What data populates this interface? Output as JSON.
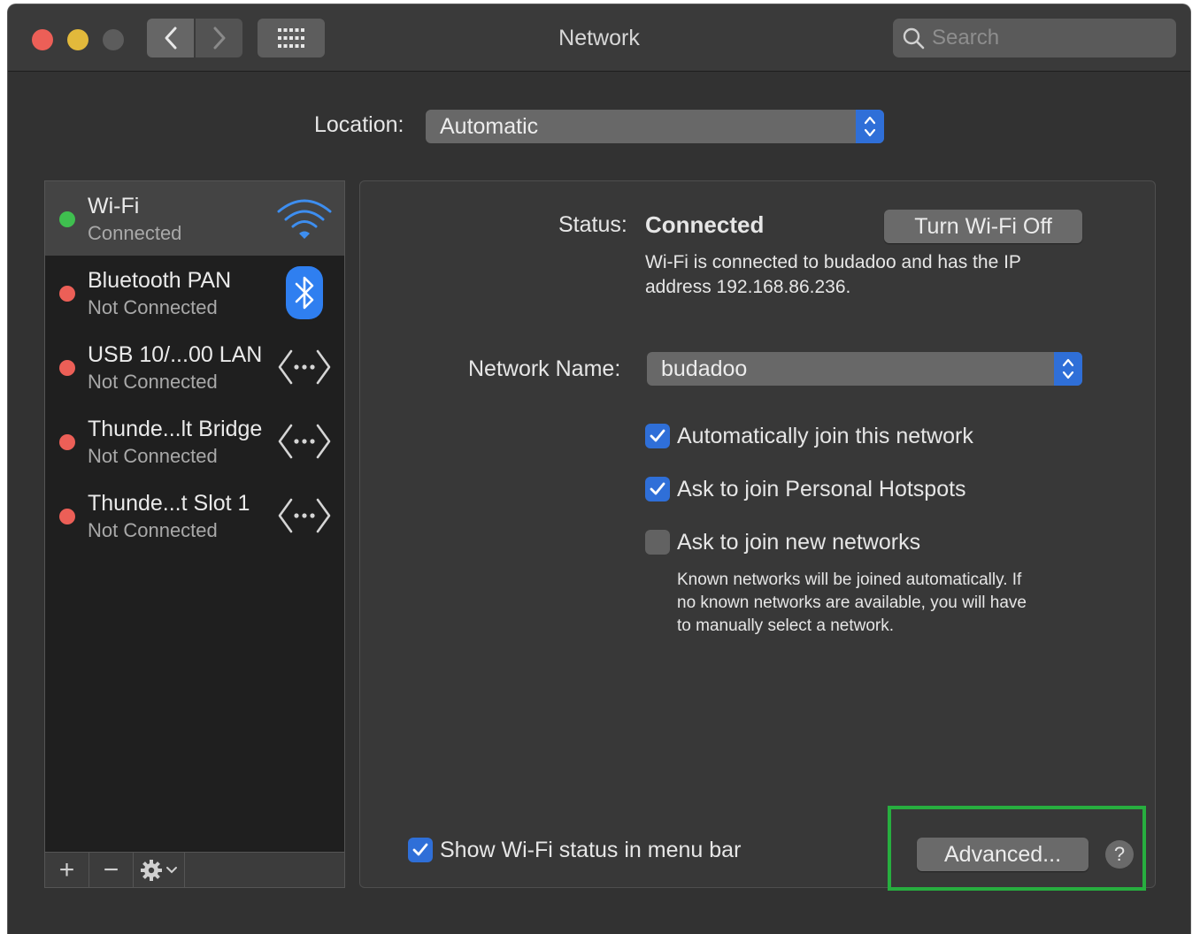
{
  "window": {
    "title": "Network"
  },
  "search": {
    "placeholder": "Search"
  },
  "location": {
    "label": "Location:",
    "value": "Automatic"
  },
  "services": [
    {
      "name": "Wi-Fi",
      "status": "Connected",
      "status_color": "#3fbf4f",
      "icon": "wifi-icon",
      "selected": true
    },
    {
      "name": "Bluetooth PAN",
      "status": "Not Connected",
      "status_color": "#ec5f57",
      "icon": "bluetooth-icon"
    },
    {
      "name": "USB 10/...00 LAN",
      "status": "Not Connected",
      "status_color": "#ec5f57",
      "icon": "network-arrows-icon"
    },
    {
      "name": "Thunde...lt Bridge",
      "status": "Not Connected",
      "status_color": "#ec5f57",
      "icon": "network-arrows-icon"
    },
    {
      "name": "Thunde...t Slot  1",
      "status": "Not Connected",
      "status_color": "#ec5f57",
      "icon": "network-arrows-icon"
    }
  ],
  "sidebar_toolbar": {
    "add": "+",
    "remove": "−"
  },
  "panel": {
    "status_label": "Status:",
    "status_value": "Connected",
    "turn_off_button": "Turn Wi-Fi Off",
    "status_desc_line1": "Wi-Fi is connected to budadoo and has the IP",
    "status_desc_line2": "address 192.168.86.236.",
    "network_name_label": "Network Name:",
    "network_name_value": "budadoo",
    "options": [
      {
        "label": "Automatically join this network",
        "checked": true
      },
      {
        "label": "Ask to join Personal Hotspots",
        "checked": true
      },
      {
        "label": "Ask to join new networks",
        "checked": false
      }
    ],
    "info_line1": "Known networks will be joined automatically. If",
    "info_line2": "no known networks are available, you will have",
    "info_line3": "to manually select a network.",
    "show_status_label": "Show Wi-Fi status in menu bar",
    "show_status_checked": true,
    "advanced_button": "Advanced...",
    "help_button": "?"
  },
  "colors": {
    "accent": "#2f6fd8",
    "highlight": "#27ae3f"
  }
}
